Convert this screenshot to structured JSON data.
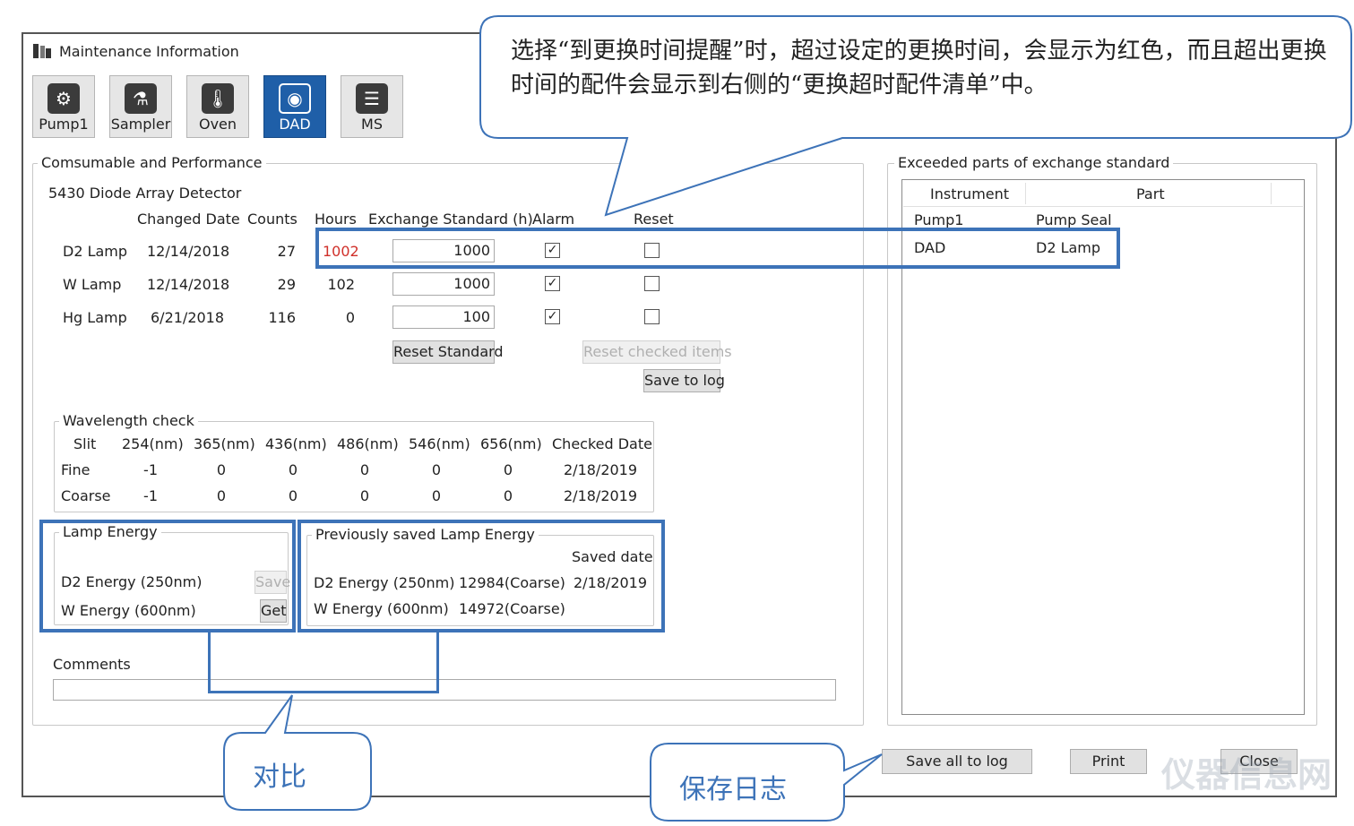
{
  "window": {
    "title": "Maintenance Information"
  },
  "toolbar": {
    "buttons": [
      "Pump1",
      "Sampler",
      "Oven",
      "DAD",
      "MS"
    ]
  },
  "consumable": {
    "legend": "Comsumable and Performance",
    "detector": "5430 Diode Array Detector",
    "headers": {
      "changed_date": "Changed Date",
      "counts": "Counts",
      "hours": "Hours",
      "exchange": "Exchange Standard (h)",
      "alarm": "Alarm",
      "reset": "Reset"
    },
    "rows": [
      {
        "name": "D2 Lamp",
        "date": "12/14/2018",
        "counts": "27",
        "hours": "1002",
        "standard": "1000",
        "alarm": true,
        "reset": false,
        "hours_color": "#d0302a"
      },
      {
        "name": "W Lamp",
        "date": "12/14/2018",
        "counts": "29",
        "hours": "102",
        "standard": "1000",
        "alarm": true,
        "reset": false
      },
      {
        "name": "Hg Lamp",
        "date": "6/21/2018",
        "counts": "116",
        "hours": "0",
        "standard": "100",
        "alarm": true,
        "reset": false
      }
    ],
    "reset_standard": "Reset Standard",
    "reset_checked": "Reset checked items",
    "save_to_log": "Save to log"
  },
  "wavelength": {
    "legend": "Wavelength check",
    "headers": [
      "Slit",
      "254(nm)",
      "365(nm)",
      "436(nm)",
      "486(nm)",
      "546(nm)",
      "656(nm)",
      "Checked Date"
    ],
    "rows": [
      [
        "Fine",
        "-1",
        "0",
        "0",
        "0",
        "0",
        "0",
        "2/18/2019"
      ],
      [
        "Coarse",
        "-1",
        "0",
        "0",
        "0",
        "0",
        "0",
        "2/18/2019"
      ]
    ]
  },
  "lamp_energy": {
    "legend": "Lamp Energy",
    "d2": "D2 Energy (250nm)",
    "w": "W Energy (600nm)",
    "save": "Save",
    "get": "Get"
  },
  "prev_energy": {
    "legend": "Previously saved Lamp Energy",
    "saved_date_label": "Saved date",
    "d2": "D2 Energy (250nm)",
    "d2_value": "12984(Coarse)",
    "d2_date": "2/18/2019",
    "w": "W Energy (600nm)",
    "w_value": "14972(Coarse)"
  },
  "comments": {
    "label": "Comments",
    "value": ""
  },
  "exceeded": {
    "legend": "Exceeded parts of exchange standard",
    "headers": [
      "Instrument",
      "Part"
    ],
    "rows": [
      [
        "Pump1",
        "Pump Seal"
      ],
      [
        "DAD",
        "D2 Lamp"
      ]
    ]
  },
  "bottom": {
    "save_all": "Save all to log",
    "print": "Print",
    "close": "Close"
  },
  "callouts": {
    "top": "选择“到更换时间提醒”时，超过设定的更换时间，会显示为红色，而且超出更换时间的配件会显示到右侧的“更换超时配件清单”中。",
    "compare": "对比",
    "save_log": "保存日志"
  },
  "watermark": "仪器信息网",
  "colors": {
    "accent": "#3d73b8",
    "active_tab": "#1f5fa8",
    "alert": "#d0302a"
  }
}
